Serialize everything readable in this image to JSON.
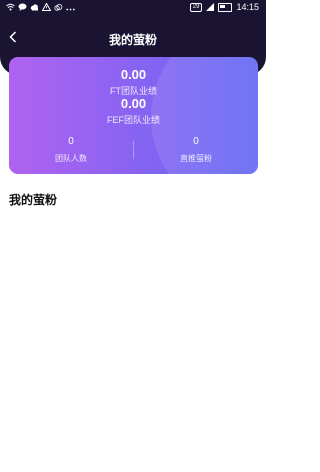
{
  "status_bar": {
    "icons": [
      "wifi-icon",
      "chat-icon",
      "cloud-icon",
      "warning-icon",
      "cloud-icon",
      "more-icon"
    ],
    "sim_badge": "29",
    "time": "14:15"
  },
  "header": {
    "title": "我的萤粉",
    "background_color": "#1a1432"
  },
  "card": {
    "ft_value": "0.00",
    "ft_label": "FT团队业绩",
    "fef_value": "0.00",
    "fef_label": "FEF团队业绩",
    "team_count_value": "0",
    "team_count_label": "团队人数",
    "direct_value": "0",
    "direct_label": "直推萤粉",
    "gradient_start": "#b063f0",
    "gradient_end": "#5f66f3"
  },
  "section": {
    "title": "我的萤粉"
  }
}
